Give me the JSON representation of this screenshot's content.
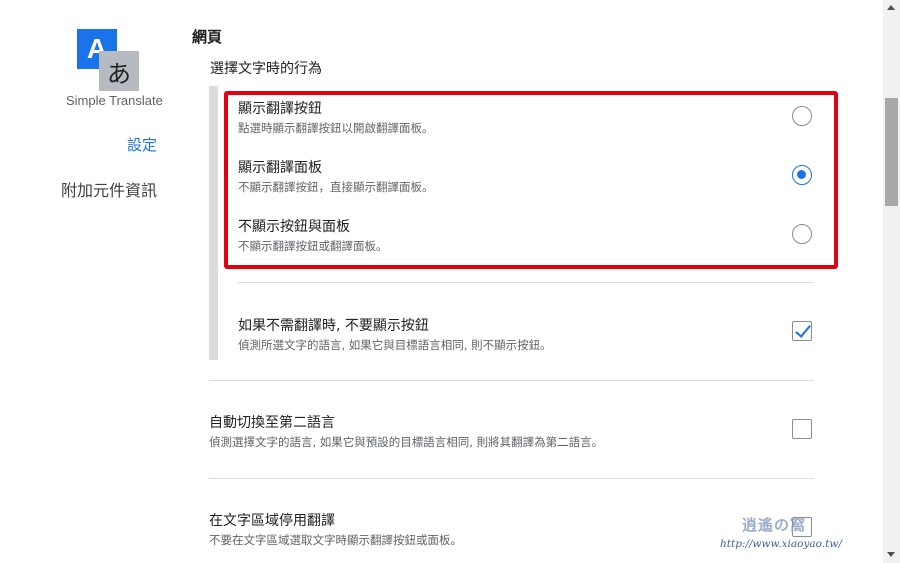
{
  "sidebar": {
    "logo": {
      "letter_a": "A",
      "letter_kana": "あ",
      "icon": "translate-app-icon"
    },
    "app_name": "Simple Translate",
    "nav": [
      {
        "label": "設定",
        "active": true
      },
      {
        "label": "附加元件資訊",
        "active": false
      }
    ]
  },
  "main": {
    "section_title": "網頁",
    "group_title": "選擇文字時的行為",
    "radio_options": [
      {
        "title": "顯示翻譯按鈕",
        "description": "點選時顯示翻譯按鈕以開啟翻譯面板。",
        "selected": false
      },
      {
        "title": "顯示翻譯面板",
        "description": "不顯示翻譯按鈕，直接顯示翻譯面板。",
        "selected": true
      },
      {
        "title": "不顯示按鈕與面板",
        "description": "不顯示翻譯按鈕或翻譯面板。",
        "selected": false
      }
    ],
    "checkbox_settings": [
      {
        "title": "如果不需翻譯時, 不要顯示按鈕",
        "description": "偵測所選文字的語言, 如果它與目標語言相同, 則不顯示按鈕。",
        "checked": true
      },
      {
        "title": "自動切換至第二語言",
        "description": "偵測選擇文字的語言, 如果它與預設的目標語言相同, 則將其翻譯為第二語言。",
        "checked": false
      },
      {
        "title": "在文字區域停用翻譯",
        "description": "不要在文字區域選取文字時顯示翻譯按鈕或面板。",
        "checked": false
      }
    ]
  },
  "watermark": {
    "logo": "逍遙の窩",
    "url": "http://www.xiaoyao.tw/"
  },
  "colors": {
    "accent": "#1a73e8",
    "highlight": "#e3000f",
    "text": "#202124",
    "secondary_text": "#5f6368"
  }
}
